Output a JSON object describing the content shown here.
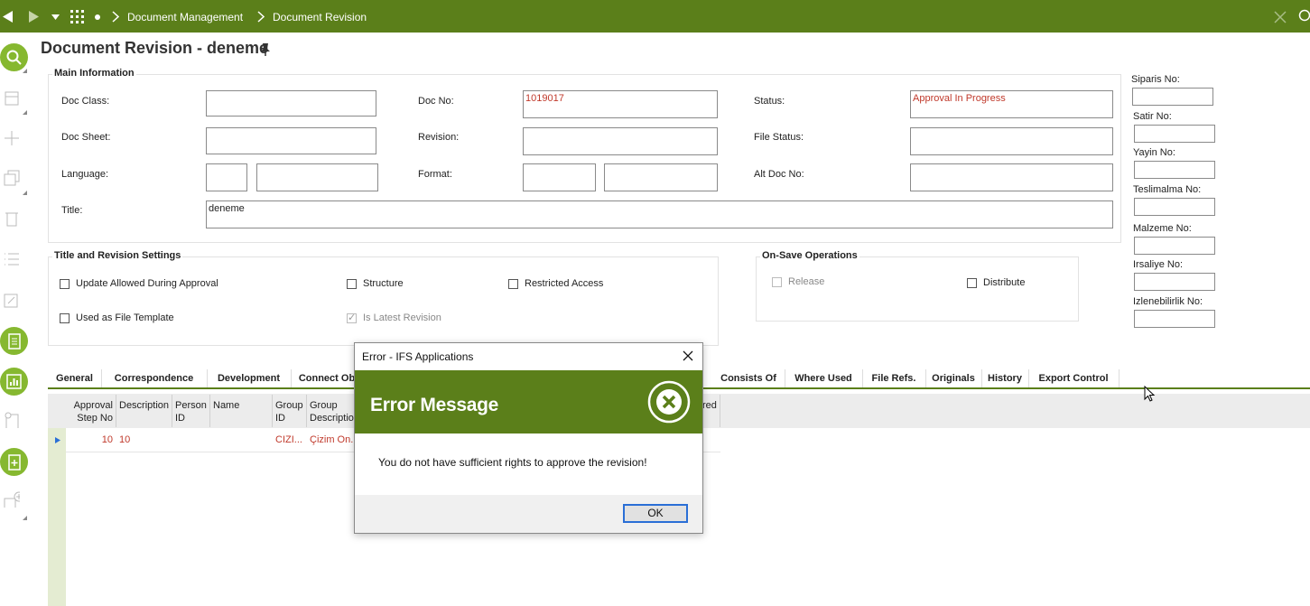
{
  "topbar": {
    "breadcrumb": [
      "Document Management",
      "Document Revision"
    ],
    "icons": [
      "back-icon",
      "forward-icon",
      "dropdown-icon",
      "apps-grid-icon",
      "dot-icon",
      "close-icon",
      "search-icon"
    ]
  },
  "page": {
    "title": "Document Revision - deneme"
  },
  "main_info": {
    "section_title": "Main Information",
    "doc_class_label": "Doc Class:",
    "doc_sheet_label": "Doc Sheet:",
    "language_label": "Language:",
    "title_label": "Title:",
    "title_value": "deneme",
    "doc_no_label": "Doc No:",
    "doc_no_value": "1019017",
    "revision_label": "Revision:",
    "format_label": "Format:",
    "status_label": "Status:",
    "status_value": "Approval In Progress",
    "file_status_label": "File Status:",
    "alt_doc_no_label": "Alt Doc No:"
  },
  "side_fields": [
    "Siparis No:",
    "Satir No:",
    "Yayin No:",
    "Teslimalma No:",
    "Malzeme No:",
    "Irsaliye No:",
    "Izlenebilirlik No:"
  ],
  "title_revision": {
    "section_title": "Title and Revision Settings",
    "update_allowed": "Update Allowed During Approval",
    "used_as_template": "Used as File Template",
    "structure": "Structure",
    "is_latest": "Is Latest Revision",
    "restricted": "Restricted Access"
  },
  "on_save": {
    "section_title": "On-Save Operations",
    "release": "Release",
    "distribute": "Distribute"
  },
  "tabs": [
    "General",
    "Correspondence",
    "Development",
    "Connect Ob",
    "Consists Of",
    "Where Used",
    "File Refs.",
    "Originals",
    "History",
    "Export Control"
  ],
  "grid": {
    "headers": {
      "approval_step": "Approval Step No",
      "description": "Description",
      "person_id": "Person ID",
      "name": "Name",
      "group_id": "Group ID",
      "group_desc": "Group Description",
      "hidden_tail": "red"
    },
    "row": {
      "approval_step": "10",
      "description": "10",
      "group_id": "CIZI...",
      "group_desc": "Çizim On..."
    }
  },
  "dialog": {
    "window_title": "Error - IFS Applications",
    "heading": "Error Message",
    "message": "You do not have sufficient rights to approve the revision!",
    "ok": "OK"
  },
  "colors": {
    "brand_green": "#5b7f1a",
    "rail_green": "#86b830",
    "error_text": "#c0392b"
  }
}
